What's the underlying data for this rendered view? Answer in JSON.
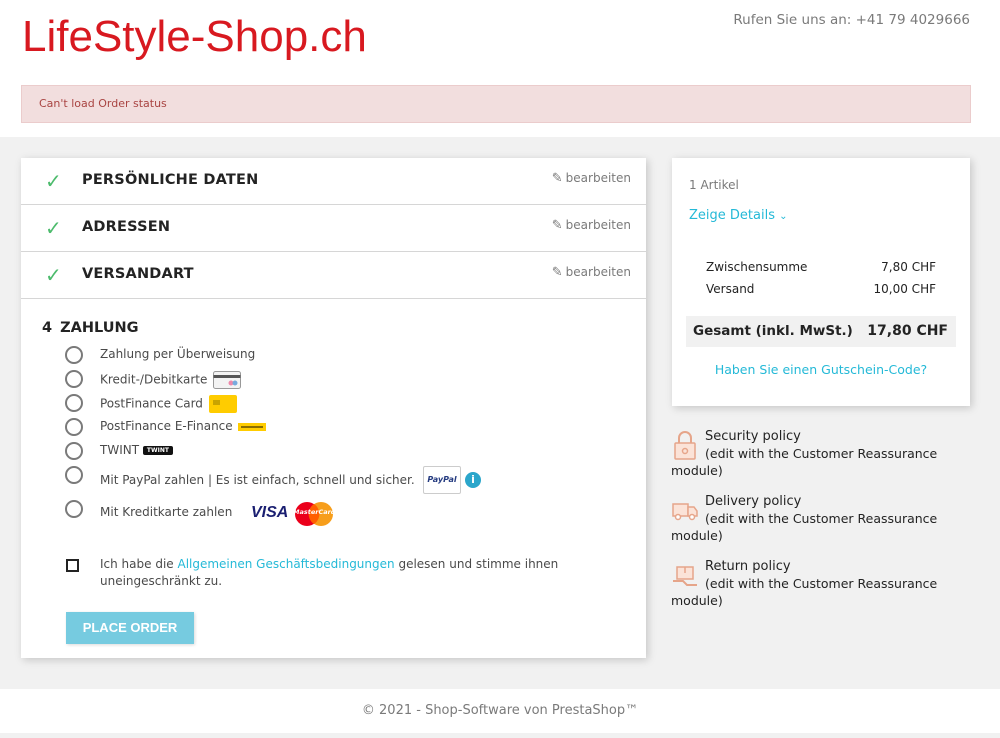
{
  "header": {
    "logo": "LifeStyle-Shop.ch",
    "phone": "Rufen Sie uns an: +41 79 4029666"
  },
  "alert": {
    "message": "Can't load Order status"
  },
  "steps": [
    {
      "title": "PERSÖNLICHE DATEN",
      "edit": "bearbeiten"
    },
    {
      "title": "ADRESSEN",
      "edit": "bearbeiten"
    },
    {
      "title": "VERSANDART",
      "edit": "bearbeiten"
    }
  ],
  "payment": {
    "number": "4",
    "title": "ZAHLUNG",
    "options": [
      {
        "label": "Zahlung per Überweisung"
      },
      {
        "label": "Kredit-/Debitkarte"
      },
      {
        "label": "PostFinance Card"
      },
      {
        "label": "PostFinance E-Finance"
      },
      {
        "label": "TWINT",
        "badge": "TWINT"
      },
      {
        "label": "Mit PayPal zahlen | Es ist einfach, schnell und sicher.",
        "badge": "PayPal"
      },
      {
        "label": "Mit Kreditkarte zahlen",
        "badge": "VISA",
        "badge2": "MasterCard"
      }
    ],
    "terms_before": "Ich habe die ",
    "terms_link": "Allgemeinen Geschäftsbedingungen",
    "terms_after": " gelesen und stimme ihnen uneingeschränkt zu.",
    "place_order": "PLACE ORDER"
  },
  "cart": {
    "items_count": "1 Artikel",
    "show_details": "Zeige Details",
    "subtotal_label": "Zwischensumme",
    "subtotal_value": "7,80 CHF",
    "shipping_label": "Versand",
    "shipping_value": "10,00 CHF",
    "total_label": "Gesamt (inkl. MwSt.)",
    "total_value": "17,80 CHF",
    "voucher": "Haben Sie einen Gutschein-Code?"
  },
  "reassurance": [
    {
      "title": "Security policy",
      "text": "(edit with the Customer Reassurance module)"
    },
    {
      "title": "Delivery policy",
      "text": "(edit with the Customer Reassurance module)"
    },
    {
      "title": "Return policy",
      "text": "(edit with the Customer Reassurance module)"
    }
  ],
  "footer": {
    "text": "© 2021 - Shop-Software von PrestaShop™"
  },
  "colors": {
    "brand": "#d81920",
    "link": "#24b9d7",
    "check": "#4cbb6c",
    "button": "#76cbe0"
  }
}
